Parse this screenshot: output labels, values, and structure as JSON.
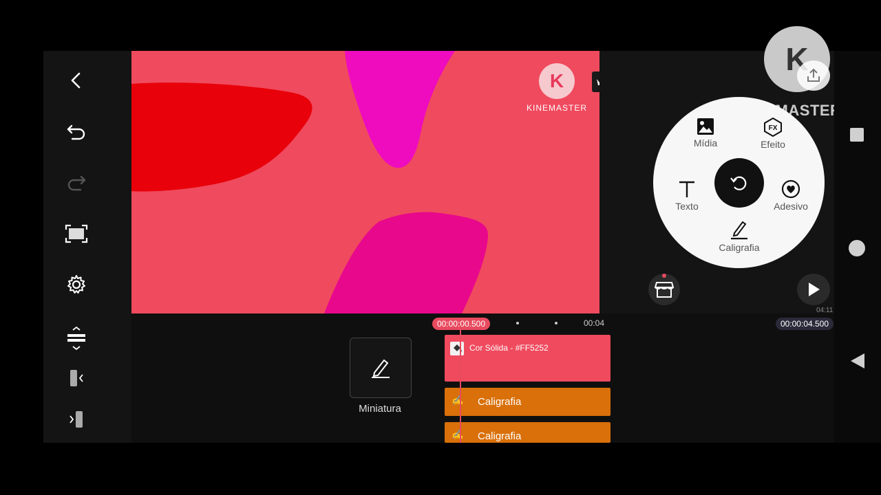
{
  "brand": {
    "preview_watermark": "KINEMASTER",
    "corner_logo_text": "KINEMASTER",
    "logo_letter": "K"
  },
  "wheel": {
    "media_label": "Mídia",
    "effect_label": "Efeito",
    "text_label": "Texto",
    "sticker_label": "Adesivo",
    "handwriting_label": "Caligrafia",
    "fx_glyph": "FX"
  },
  "timeline": {
    "current_time": "00:00:00.500",
    "tick_label": "00:04",
    "total_time": "00:00:04.500",
    "small_time": "04:11",
    "thumbnail_label": "Miniatura",
    "tracks": [
      {
        "label": "Cor Sólida - #FF5252",
        "color": "#F04A5E"
      },
      {
        "label": "Caligrafia",
        "color": "#D9700A"
      },
      {
        "label": "Caligrafia",
        "color": "#D9700A"
      }
    ]
  },
  "colors": {
    "preview_bg": "#F04A5E",
    "red_stroke": "#E8000A",
    "magenta_stroke": "#EE0CBE",
    "pink_stroke": "#E8088C",
    "playhead": "#E84A5F",
    "accent_orange": "#D9700A"
  },
  "icons": {
    "back": "back-icon",
    "undo": "undo-icon",
    "redo": "redo-icon",
    "fullscreen": "fullscreen-icon",
    "settings": "gear-icon",
    "store": "store-icon",
    "play": "play-icon",
    "share": "share-icon",
    "crown": "crown-icon"
  }
}
